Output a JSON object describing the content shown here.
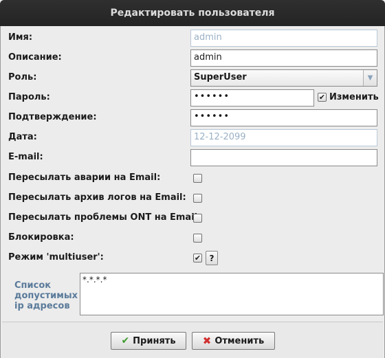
{
  "window": {
    "title": "Редактировать пользователя"
  },
  "form": {
    "name": {
      "label": "Имя:",
      "value": "admin"
    },
    "description": {
      "label": "Описание:",
      "value": "admin"
    },
    "role": {
      "label": "Роль:",
      "value": "SuperUser"
    },
    "password": {
      "label": "Пароль:",
      "value": "••••••",
      "change_label": "Изменить",
      "change_checked": "✔"
    },
    "confirm": {
      "label": "Подтверждение:",
      "value": "••••••"
    },
    "date": {
      "label": "Дата:",
      "value": "12-12-2099"
    },
    "email": {
      "label": "E-mail:",
      "value": ""
    },
    "forward_alarms": {
      "label": "Пересылать аварии на Email:",
      "checked": ""
    },
    "forward_logs": {
      "label": "Пересылать архив логов на Email:",
      "checked": ""
    },
    "forward_ont": {
      "label": "Пересылать проблемы ONT на Email:",
      "checked": ""
    },
    "blocking": {
      "label": "Блокировка:",
      "checked": ""
    },
    "multiuser": {
      "label": "Режим 'multiuser':",
      "checked": "✔",
      "help_label": "?"
    },
    "ip_list": {
      "label_line1": "Список",
      "label_line2": "допустимых",
      "label_line3": "ip адресов",
      "value": "*.*.*.*"
    }
  },
  "buttons": {
    "ok": {
      "label": "Принять"
    },
    "cancel": {
      "label": "Отменить"
    }
  },
  "icons": {
    "ok": "check-icon",
    "cancel": "x-icon",
    "dropdown": "chevron-down-icon"
  }
}
